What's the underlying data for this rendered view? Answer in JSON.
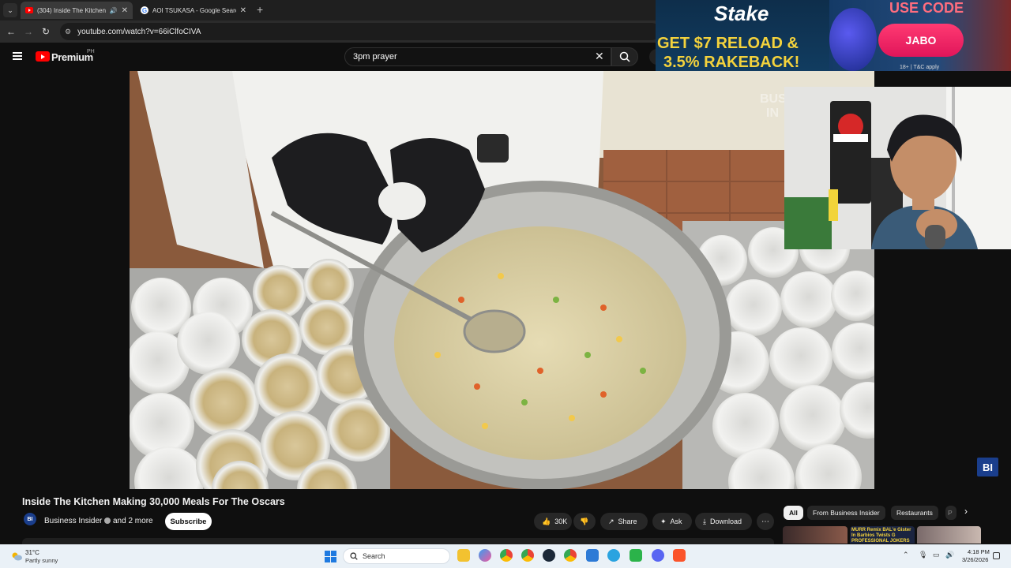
{
  "browser": {
    "tabs": [
      {
        "title": "(304) Inside The Kitchen Ma",
        "active": true
      },
      {
        "title": "AOI TSUKASA - Google Search",
        "active": false
      }
    ],
    "url": "youtube.com/watch?v=66iClfoCIVA"
  },
  "youtube": {
    "logo_text": "Premium",
    "region": "PH",
    "search_query": "3pm prayer"
  },
  "ad": {
    "brand": "Stake",
    "line1": "GET $7 RELOAD &",
    "line2": "3.5% RAKEBACK!",
    "use_code_label": "USE CODE",
    "code": "JABO",
    "terms": "18+ | T&C apply"
  },
  "video": {
    "title": "Inside The Kitchen Making 30,000 Meals For The Oscars",
    "watermark": "BI",
    "channel": {
      "avatar_text": "BI",
      "name": "Business Insider",
      "more": "and 2 more",
      "subscribe_label": "Subscribe"
    },
    "actions": {
      "likes": "30K",
      "share": "Share",
      "ask": "Ask",
      "download": "Download"
    }
  },
  "sidebar": {
    "chips": [
      "All",
      "From Business Insider",
      "Restaurants",
      "P"
    ],
    "thumbnail_text": "MURR Remix BAL'e Gister In Barbios Twists G PROFESSIONAL JOKERS"
  },
  "taskbar": {
    "weather_temp": "31°C",
    "weather_desc": "Partly sunny",
    "search_placeholder": "Search",
    "time": "4:18 PM",
    "date": "3/26/2026"
  },
  "colors": {
    "youtube_red": "#ff0000",
    "ad_yellow": "#f4d23c",
    "ad_pink": "#e0155a",
    "bi_blue": "#1a3e8c"
  }
}
